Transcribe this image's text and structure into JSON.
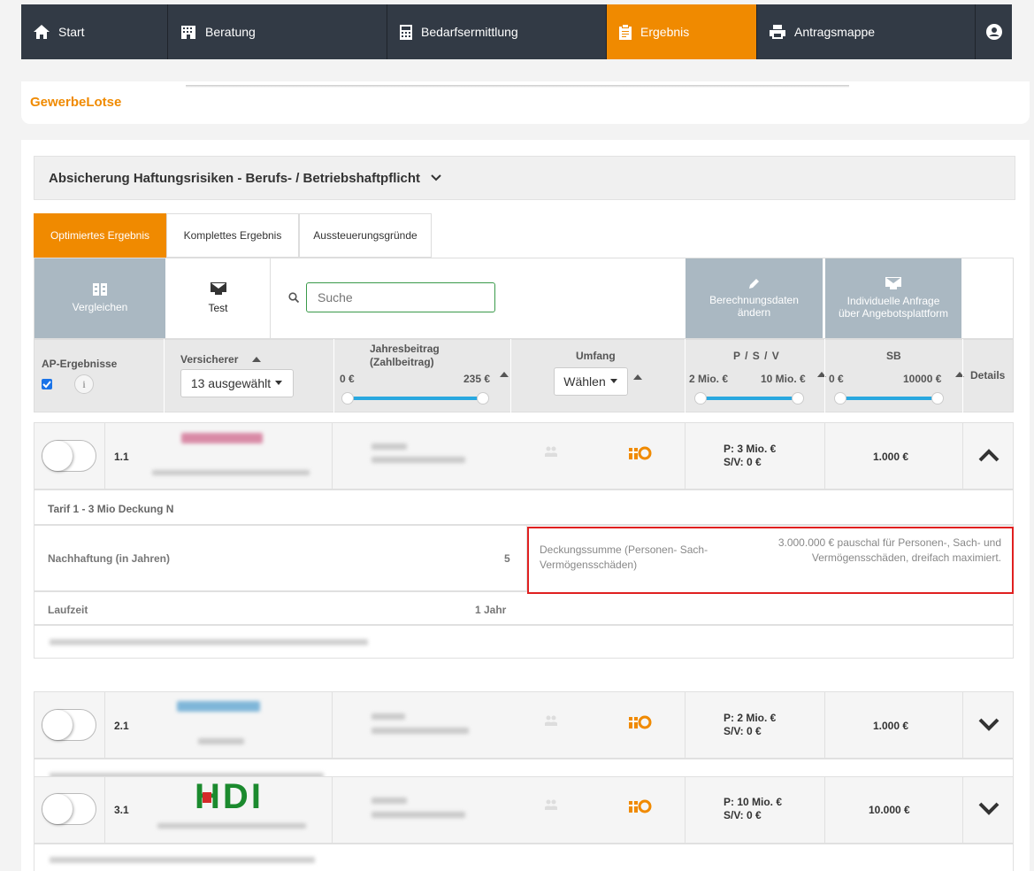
{
  "nav": {
    "items": [
      {
        "label": "Start",
        "icon": "home-icon"
      },
      {
        "label": "Beratung",
        "icon": "building-icon"
      },
      {
        "label": "Bedarfsermittlung",
        "icon": "calculator-icon"
      },
      {
        "label": "Ergebnis",
        "icon": "clipboard-icon",
        "active": true
      },
      {
        "label": "Antragsmappe",
        "icon": "printer-icon"
      }
    ],
    "user_icon": "user-circle-icon"
  },
  "brand": "GewerbeLotse",
  "section": {
    "title": "Absicherung Haftungsrisiken - Berufs- / Betriebshaftpflicht"
  },
  "tabs": [
    "Optimiertes Ergebnis",
    "Komplettes Ergebnis",
    "Aussteuerungsgründe"
  ],
  "toolbar": {
    "compare": "Vergleichen",
    "test": "Test",
    "search_placeholder": "Suche",
    "calc_data_line1": "Berechnungsdaten",
    "calc_data_line2": "ändern",
    "request_line1": "Individuelle Anfrage",
    "request_line2": "über Angebotsplattform"
  },
  "table_header": {
    "ap": "AP-Ergebnisse",
    "insurer": "Versicherer",
    "insurer_select": "13 ausgewählt",
    "premium_line1": "Jahresbeitrag",
    "premium_line2": "(Zahlbeitrag)",
    "premium_min": "0 €",
    "premium_max": "235 €",
    "scope": "Umfang",
    "scope_select": "Wählen",
    "psv": "P / S / V",
    "psv_min": "2 Mio. €",
    "psv_max": "10 Mio. €",
    "sb": "SB",
    "sb_min": "0 €",
    "sb_max": "10000 €",
    "details": "Details"
  },
  "accent": "#f08a00",
  "slider_color": "#29a8e0",
  "results": [
    {
      "rank": "1.1",
      "psv_line1": "P: 3 Mio. €",
      "psv_line2": "S/V: 0 €",
      "sb": "1.000 €",
      "expanded": true
    },
    {
      "rank": "2.1",
      "psv_line1": "P: 2 Mio. €",
      "psv_line2": "S/V: 0 €",
      "sb": "1.000 €",
      "expanded": false
    },
    {
      "rank": "3.1",
      "insurer_logo": "HDI",
      "psv_line1": "P: 10 Mio. €",
      "psv_line2": "S/V: 0 €",
      "sb": "10.000 €",
      "expanded": false
    }
  ],
  "details": {
    "tariff": "Tarif 1 - 3 Mio Deckung N",
    "nachhaftung_label": "Nachhaftung (in Jahren)",
    "nachhaftung_value": "5",
    "laufzeit_label": "Laufzeit",
    "laufzeit_value": "1 Jahr",
    "coverage_label": "Deckungssumme (Personen- Sach- Vermögensschäden)",
    "coverage_value": "3.000.000 € pauschal für Personen-, Sach- und Vermögensschäden, dreifach maximiert."
  }
}
